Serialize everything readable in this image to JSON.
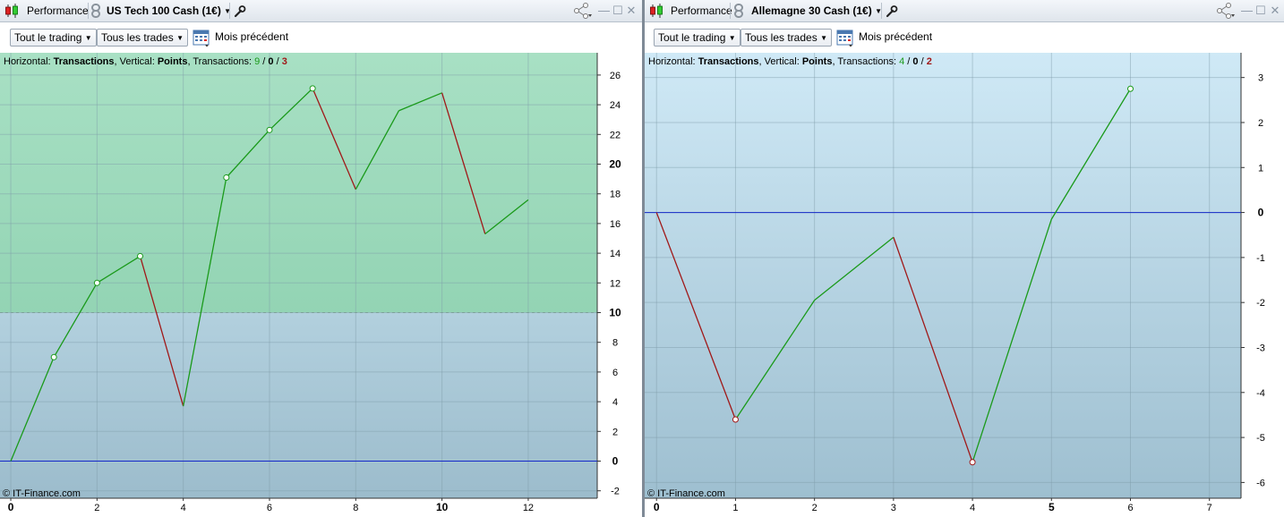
{
  "panels": [
    {
      "title": "Performance",
      "instrument": "US Tech 100 Cash (1€)",
      "filters": {
        "trading": "Tout le trading",
        "trades": "Tous les trades",
        "period": "Mois précédent"
      },
      "info": {
        "horizontal_label": "Horizontal:",
        "horizontal_value": "Transactions",
        "vertical_label": "Vertical:",
        "vertical_value": "Points",
        "transactions_label": "Transactions:",
        "wins": "9",
        "neutral": "0",
        "losses": "3",
        "sep": "/"
      },
      "copyright": "© IT-Finance.com",
      "bg_split_y": 10,
      "chart_data": {
        "type": "line",
        "x": [
          0,
          1,
          2,
          3,
          4,
          5,
          6,
          7,
          8,
          9,
          10,
          11,
          12
        ],
        "y": [
          0,
          7,
          12,
          13.8,
          3.7,
          19.1,
          22.3,
          25.1,
          18.3,
          23.6,
          24.8,
          15.3,
          17.6
        ],
        "xlim": [
          -0.25,
          13.6
        ],
        "ylim": [
          -2.5,
          27.5
        ],
        "xticks": [
          "0",
          "2",
          "4",
          "6",
          "8",
          "10",
          "12"
        ],
        "bold_xticks": [
          "0",
          "10"
        ],
        "yticks": [
          "-2",
          "0",
          "2",
          "4",
          "6",
          "8",
          "10",
          "12",
          "14",
          "16",
          "18",
          "20",
          "22",
          "24",
          "26"
        ],
        "bold_yticks": [
          "0",
          "10",
          "20"
        ],
        "zero_line": 0,
        "markers_at": [
          1,
          2,
          3,
          5,
          6,
          7
        ],
        "colors": {
          "up": "#1a9a1a",
          "down": "#a01818",
          "zero": "#1428c8",
          "top_bg": "#a8e0c4",
          "bottom_bg": "#a8c8d8"
        }
      }
    },
    {
      "title": "Performance",
      "instrument": "Allemagne 30 Cash (1€)",
      "filters": {
        "trading": "Tout le trading",
        "trades": "Tous les trades",
        "period": "Mois précédent"
      },
      "info": {
        "horizontal_label": "Horizontal:",
        "horizontal_value": "Transactions",
        "vertical_label": "Vertical:",
        "vertical_value": "Points",
        "transactions_label": "Transactions:",
        "wins": "4",
        "neutral": "0",
        "losses": "2",
        "sep": "/"
      },
      "copyright": "© IT-Finance.com",
      "chart_data": {
        "type": "line",
        "x": [
          0,
          1,
          2,
          3,
          4,
          5,
          6
        ],
        "y": [
          0,
          -4.6,
          -1.95,
          -0.55,
          -5.55,
          -0.15,
          2.75
        ],
        "xlim": [
          -0.15,
          7.4
        ],
        "ylim": [
          -6.35,
          3.55
        ],
        "xticks": [
          "0",
          "1",
          "2",
          "3",
          "4",
          "5",
          "6",
          "7"
        ],
        "bold_xticks": [
          "0",
          "5"
        ],
        "yticks": [
          "-6",
          "-5",
          "-4",
          "-3",
          "-2",
          "-1",
          "0",
          "1",
          "2",
          "3"
        ],
        "bold_yticks": [
          "0"
        ],
        "zero_line": 0,
        "markers_at": [
          1,
          4,
          6
        ],
        "colors": {
          "up": "#1a9a1a",
          "down": "#a01818",
          "zero": "#1428c8",
          "top_bg": "#cfe9f6",
          "bottom_bg": "#9ebfd0"
        }
      }
    }
  ]
}
